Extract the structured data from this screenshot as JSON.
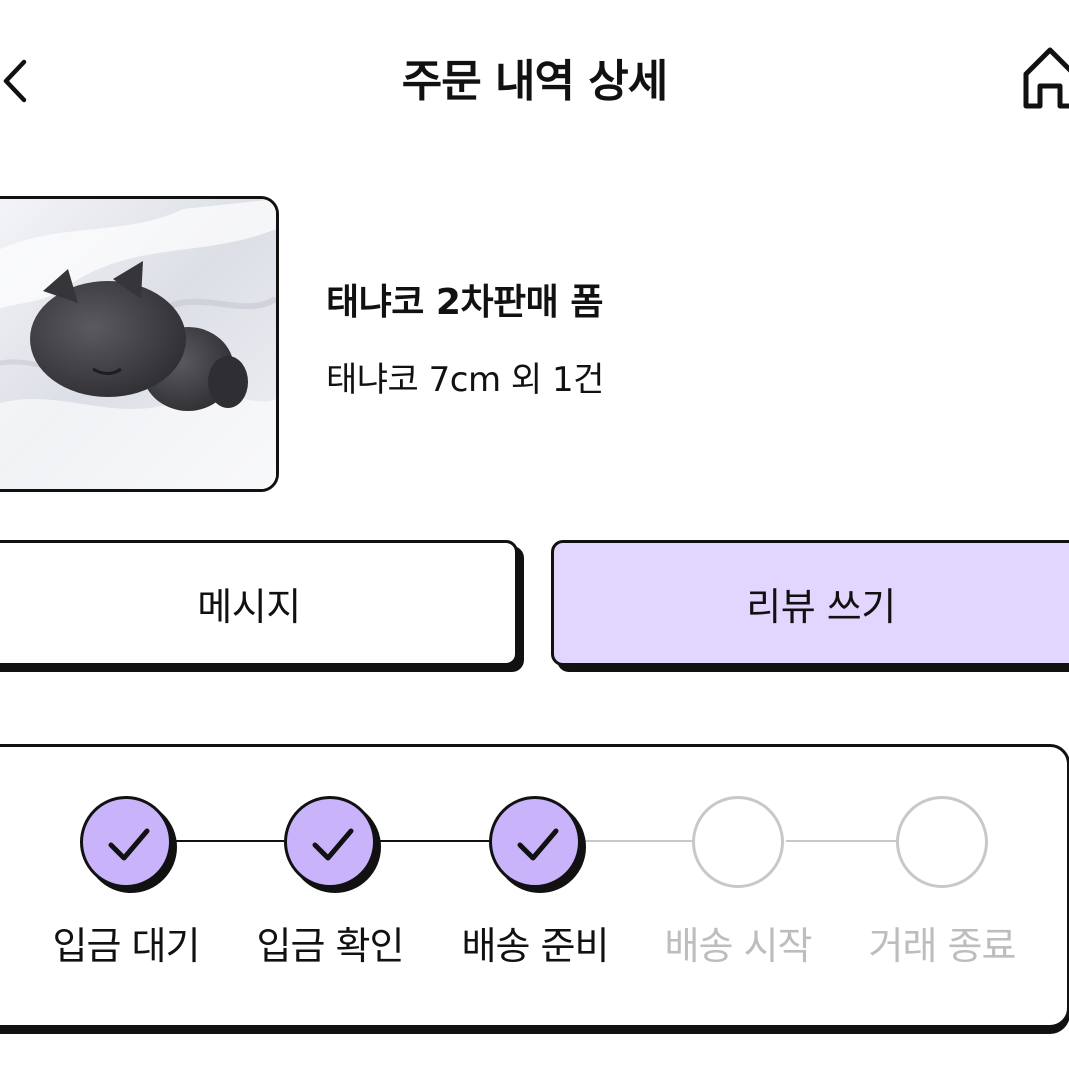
{
  "header": {
    "title": "주문 내역 상세",
    "back_icon": "chevron-left-icon",
    "home_icon": "home-icon"
  },
  "product": {
    "name": "태냐코 2차판매 폼",
    "summary": "태냐코 7cm 외 1건"
  },
  "actions": {
    "message_label": "메시지",
    "review_label": "리뷰 쓰기"
  },
  "progress": {
    "steps": [
      {
        "label": "입금 대기",
        "done": true
      },
      {
        "label": "입금 확인",
        "done": true
      },
      {
        "label": "배송 준비",
        "done": true
      },
      {
        "label": "배송 시작",
        "done": false
      },
      {
        "label": "거래 종료",
        "done": false
      }
    ]
  },
  "colors": {
    "accent": "#c9b4fb",
    "accent_light": "#e2d6ff",
    "inactive": "#c8c8c8",
    "ink": "#111111"
  }
}
